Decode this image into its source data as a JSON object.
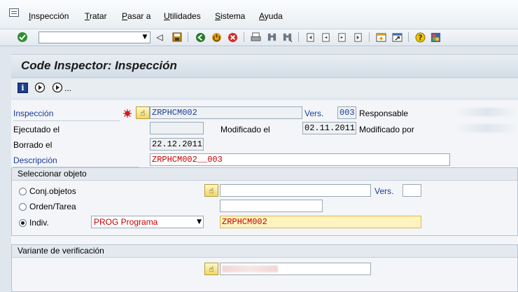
{
  "menu": [
    {
      "label": "Inspección",
      "accel": "I"
    },
    {
      "label": "Tratar",
      "accel": "T"
    },
    {
      "label": "Pasar a",
      "accel": "P"
    },
    {
      "label": "Utilidades",
      "accel": "U"
    },
    {
      "label": "Sistema",
      "accel": "S"
    },
    {
      "label": "Ayuda",
      "accel": "A"
    }
  ],
  "toolbar": {
    "command_value": "",
    "icons": [
      "enter-icon",
      "back-nav-icon",
      "save-icon",
      "back-icon",
      "exit-icon",
      "cancel-icon",
      "print-icon",
      "find-icon",
      "find-next-icon",
      "first-page-icon",
      "prev-page-icon",
      "next-page-icon",
      "last-page-icon",
      "create-session-icon",
      "shortcut-icon",
      "help-icon",
      "customize-icon"
    ]
  },
  "title": "Code Inspector: Inspección",
  "app_toolbar": {
    "more": "..."
  },
  "form": {
    "inspeccion_label": "Inspección",
    "inspeccion_value": "ZRPHCM002",
    "vers_label": "Vers.",
    "vers_value": "003",
    "responsable_label": "Responsable",
    "ejecutado_label": "Ejecutado el",
    "ejecutado_value": "",
    "modificado_label": "Modificado el",
    "modificado_value": "02.11.2011",
    "modificado_por_label": "Modificado por",
    "borrado_label": "Borrado el",
    "borrado_value": "22.12.2011",
    "descripcion_label": "Descripción",
    "descripcion_value": "ZRPHCM002__003"
  },
  "seleccionar": {
    "title": "Seleccionar objeto",
    "conj_label": "Conj.objetos",
    "conj_value": "",
    "vers_label": "Vers.",
    "vers_value": "",
    "orden_label": "Orden/Tarea",
    "orden_value": "",
    "indiv_label": "Indiv.",
    "indiv_type": "PROG Programa",
    "indiv_value": "ZRPHCM002",
    "selected": "indiv"
  },
  "variante": {
    "title": "Variante de verificación"
  }
}
